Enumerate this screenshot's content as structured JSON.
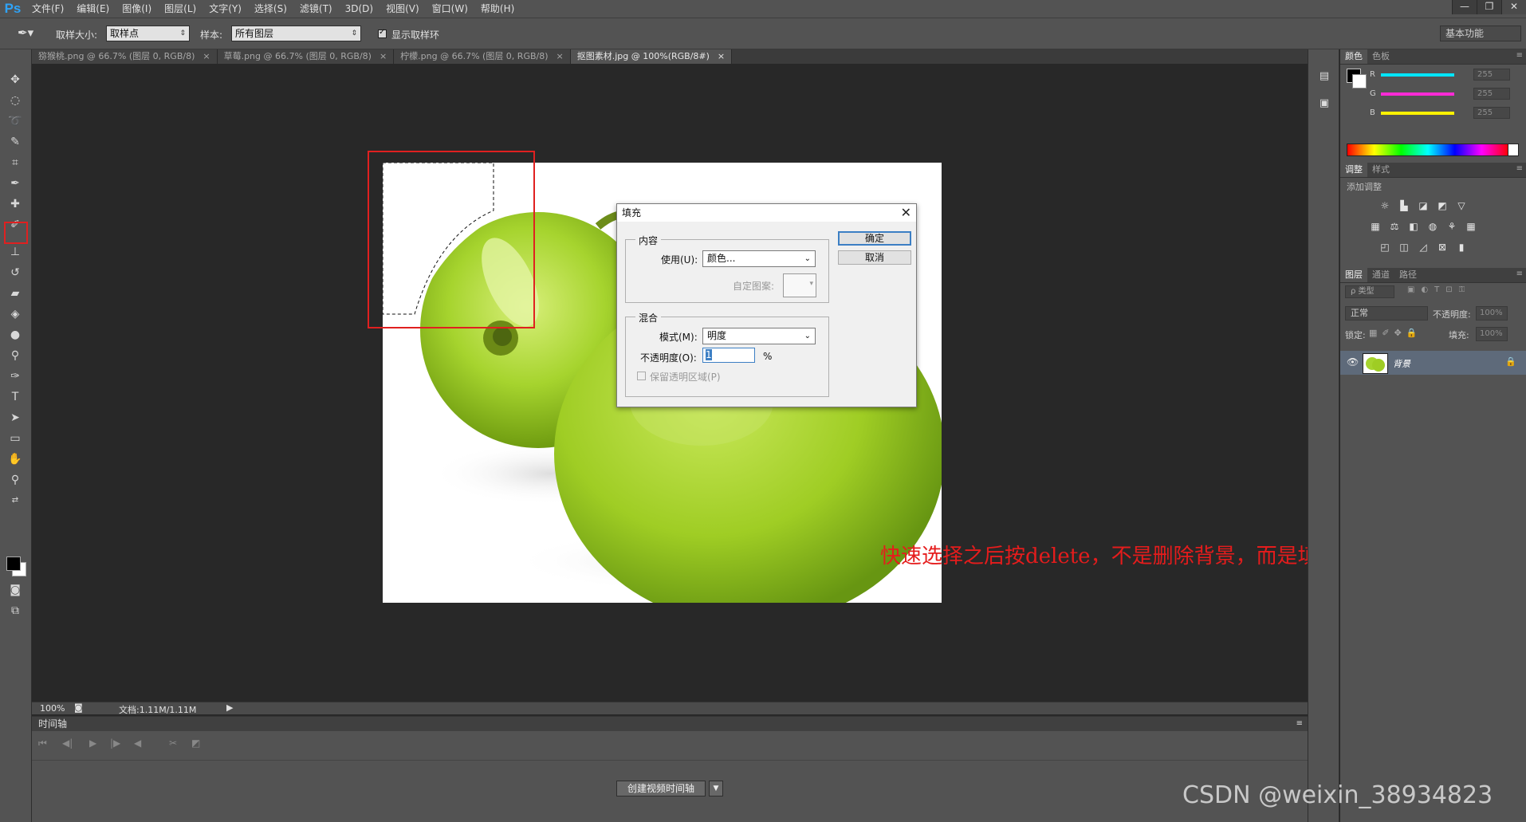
{
  "app": {
    "logo": "Ps",
    "menu": [
      "文件(F)",
      "编辑(E)",
      "图像(I)",
      "图层(L)",
      "文字(Y)",
      "选择(S)",
      "滤镜(T)",
      "3D(D)",
      "视图(V)",
      "窗口(W)",
      "帮助(H)"
    ],
    "window_controls": [
      "—",
      "❐",
      "✕"
    ]
  },
  "options_bar": {
    "sample_size_label": "取样大小:",
    "sample_size_value": "取样点",
    "sample_label": "样本:",
    "sample_value": "所有图层",
    "show_ring_label": "显示取样环",
    "show_ring_checked": true,
    "workspace": "基本功能"
  },
  "tabs": [
    {
      "label": "猕猴桃.png @ 66.7% (图层 0, RGB/8)",
      "active": false
    },
    {
      "label": "草莓.png @ 66.7% (图层 0, RGB/8)",
      "active": false
    },
    {
      "label": "柠檬.png @ 66.7% (图层 0, RGB/8)",
      "active": false
    },
    {
      "label": "抠图素材.jpg @ 100%(RGB/8#)",
      "active": true
    }
  ],
  "status": {
    "zoom": "100%",
    "doc_info": "文档:1.11M/1.11M"
  },
  "timeline": {
    "title": "时间轴",
    "create_button": "创建视频时间轴"
  },
  "color_panel": {
    "tabs": [
      "颜色",
      "色板"
    ],
    "channels": [
      {
        "label": "R",
        "value": "255",
        "color": "#00e5ff"
      },
      {
        "label": "G",
        "value": "255",
        "color": "#ff2bd6"
      },
      {
        "label": "B",
        "value": "255",
        "color": "#fff200"
      }
    ]
  },
  "adjust_panel": {
    "tabs": [
      "调整",
      "样式"
    ],
    "add_label": "添加调整"
  },
  "layers_panel": {
    "tabs": [
      "图层",
      "通道",
      "路径"
    ],
    "kind_filter": "ρ 类型",
    "blend_mode": "正常",
    "opacity_label": "不透明度:",
    "opacity_value": "100%",
    "lock_label": "锁定:",
    "fill_label": "填充:",
    "fill_value": "100%",
    "layers": [
      {
        "name": "背景",
        "visible": true,
        "locked": true
      }
    ]
  },
  "fill_dialog": {
    "title": "填充",
    "content_group": "内容",
    "use_label": "使用(U):",
    "use_value": "颜色...",
    "custom_pattern_label": "自定图案:",
    "blend_group": "混合",
    "mode_label": "模式(M):",
    "mode_value": "明度",
    "opacity_label": "不透明度(O):",
    "opacity_value": "1",
    "opacity_unit": "%",
    "preserve_label": "保留透明区域(P)",
    "ok": "确定",
    "cancel": "取消"
  },
  "annotation": "快速选择之后按delete，不是删除背景，而是填充",
  "watermark": "CSDN @weixin_38934823",
  "colors": {
    "annotation_red": "#e51c1c",
    "apple_green": "#9fd12b",
    "ps_blue": "#2fa3f7"
  }
}
